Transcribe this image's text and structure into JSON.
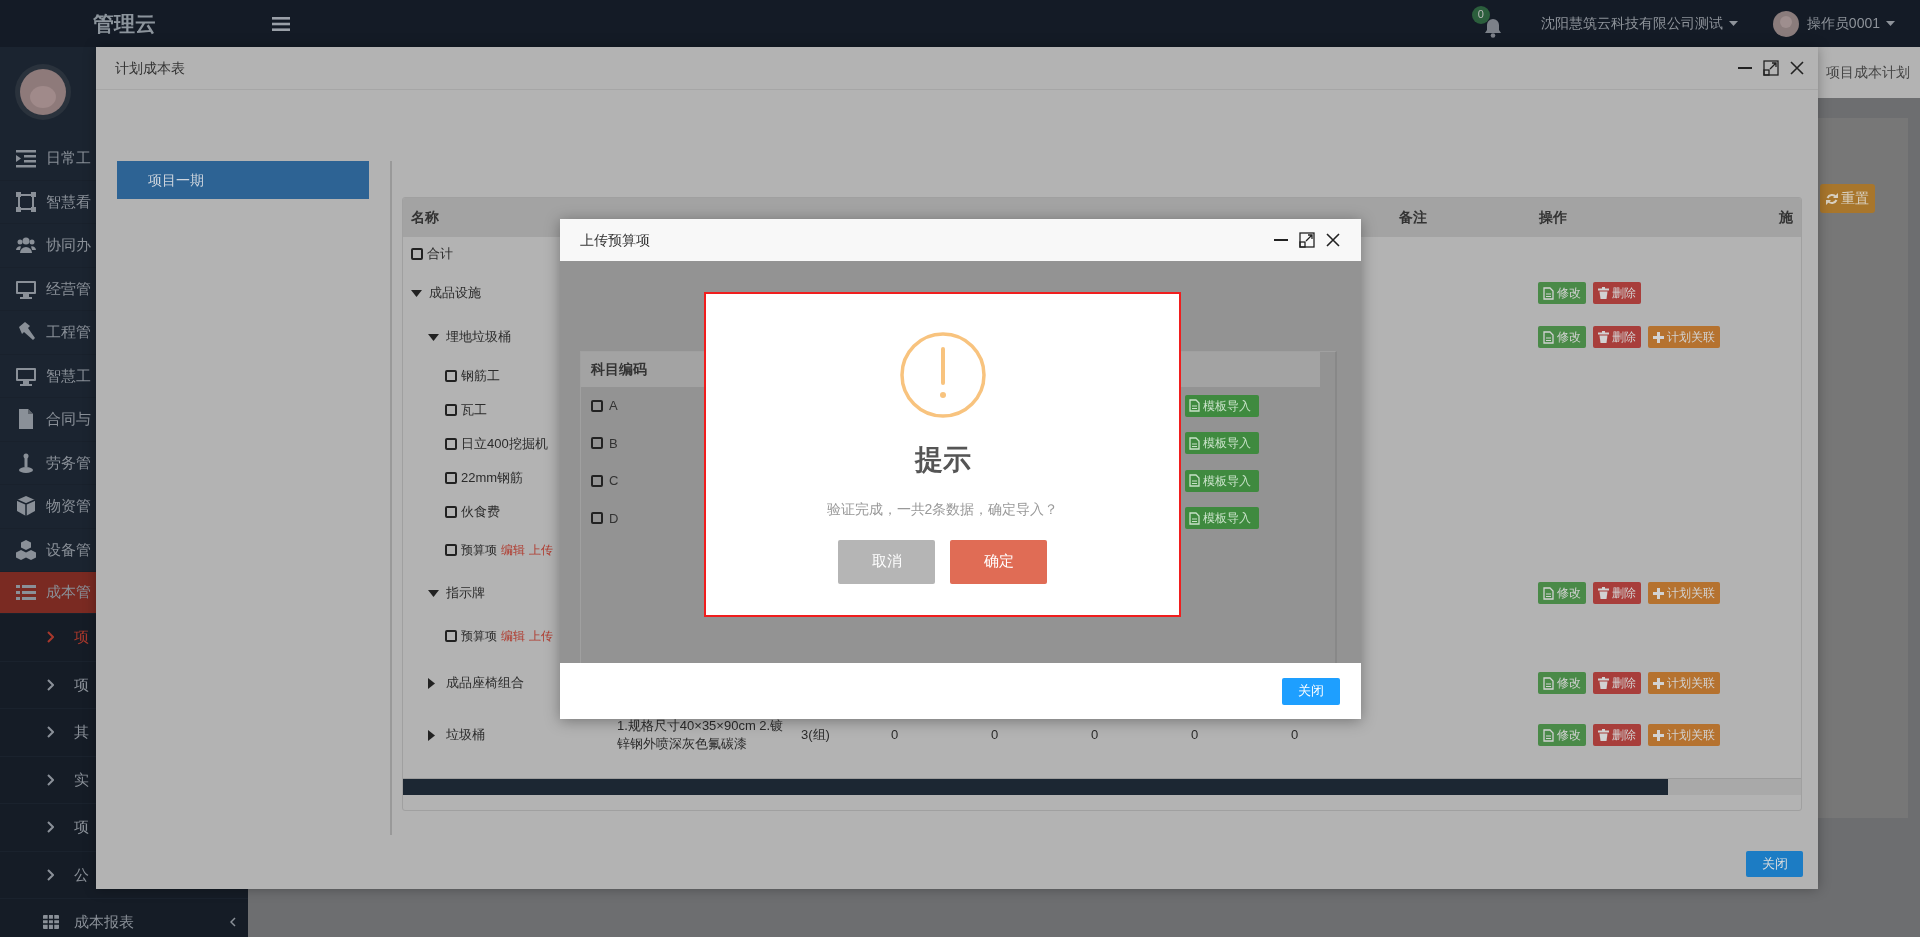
{
  "topbar": {
    "logo": "管理云",
    "notification_count": "0",
    "company": "沈阳慧筑云科技有限公司测试",
    "user": "操作员0001"
  },
  "sidebar": {
    "items": [
      {
        "label": "日常工",
        "selected": false
      },
      {
        "label": "智慧看",
        "selected": false
      },
      {
        "label": "协同办",
        "selected": false
      },
      {
        "label": "经营管",
        "selected": false
      },
      {
        "label": "工程管",
        "selected": false
      },
      {
        "label": "智慧工",
        "selected": false
      },
      {
        "label": "合同与",
        "selected": false
      },
      {
        "label": "劳务管",
        "selected": false
      },
      {
        "label": "物资管",
        "selected": false
      },
      {
        "label": "设备管",
        "selected": false
      },
      {
        "label": "成本管",
        "selected": true,
        "children": [
          {
            "label": "项",
            "kind": "link",
            "selected": true
          },
          {
            "label": "项",
            "kind": "link",
            "selected": false
          },
          {
            "label": "其",
            "kind": "link",
            "selected": false
          },
          {
            "label": "实",
            "kind": "link",
            "selected": false
          },
          {
            "label": "项",
            "kind": "link",
            "selected": false
          },
          {
            "label": "公",
            "kind": "link",
            "selected": false
          },
          {
            "label": "成本报表",
            "kind": "group",
            "selected": false
          }
        ]
      }
    ]
  },
  "page": {
    "breadcrumb": "项目成本计划",
    "reset_button": "重置"
  },
  "plan_window": {
    "title": "计划成本表",
    "projects": [
      {
        "label": "项目一期",
        "selected": true
      }
    ],
    "table": {
      "columns": [
        {
          "label": "名称",
          "kind": "name"
        },
        {
          "label": "备注",
          "kind": "remark"
        },
        {
          "label": "操作",
          "kind": "actions"
        },
        {
          "label": "施",
          "kind": "extra"
        }
      ],
      "rows": [
        {
          "name": "合计",
          "kind": "item",
          "checked": false
        },
        {
          "name": "成品设施",
          "kind": "group",
          "expanded": true,
          "actions": [
            {
              "label": "修改",
              "kind": "edit"
            },
            {
              "label": "删除",
              "kind": "delete"
            }
          ],
          "children": [
            {
              "name": "埋地垃圾桶",
              "kind": "group",
              "expanded": true,
              "actions": [
                {
                  "label": "修改",
                  "kind": "edit"
                },
                {
                  "label": "删除",
                  "kind": "delete"
                },
                {
                  "label": "计划关联",
                  "kind": "link"
                }
              ],
              "children": [
                {
                  "name": "钢筋工",
                  "kind": "item",
                  "checked": false
                },
                {
                  "name": "瓦工",
                  "kind": "item",
                  "checked": false
                },
                {
                  "name": "日立400挖掘机",
                  "kind": "item",
                  "checked": false
                },
                {
                  "name": "22mm钢筋",
                  "kind": "item",
                  "checked": false
                },
                {
                  "name": "伙食费",
                  "kind": "item",
                  "checked": false
                },
                {
                  "name": "预算项",
                  "kind": "budget",
                  "checked": false,
                  "links": [
                    "编辑",
                    "上传"
                  ]
                }
              ]
            },
            {
              "name": "指示牌",
              "kind": "group",
              "expanded": true,
              "actions": [
                {
                  "label": "修改",
                  "kind": "edit"
                },
                {
                  "label": "删除",
                  "kind": "delete"
                },
                {
                  "label": "计划关联",
                  "kind": "link"
                }
              ],
              "children": [
                {
                  "name": "预算项",
                  "kind": "budget",
                  "checked": false,
                  "links": [
                    "编辑",
                    "上传"
                  ]
                }
              ]
            },
            {
              "name": "成品座椅组合",
              "kind": "group",
              "expanded": false,
              "actions": [
                {
                  "label": "修改",
                  "kind": "edit"
                },
                {
                  "label": "删除",
                  "kind": "delete"
                },
                {
                  "label": "计划关联",
                  "kind": "link"
                }
              ]
            },
            {
              "name": "垃圾桶",
              "kind": "group",
              "expanded": false,
              "cells": [
                "1.规格尺寸40×35×90cm 2.镀锌钢外喷深灰色氟碳漆",
                "3(组)",
                "0",
                "0",
                "0",
                "0",
                "0"
              ],
              "actions": [
                {
                  "label": "修改",
                  "kind": "edit"
                },
                {
                  "label": "删除",
                  "kind": "delete"
                },
                {
                  "label": "计划关联",
                  "kind": "link"
                }
              ]
            }
          ]
        }
      ]
    },
    "close_button": "关闭"
  },
  "upload_window": {
    "title": "上传预算项",
    "table": {
      "columns": [
        "科目编码"
      ],
      "rows": [
        {
          "code": "A",
          "checked": false,
          "action": "模板导入"
        },
        {
          "code": "B",
          "checked": false,
          "action": "模板导入"
        },
        {
          "code": "C",
          "checked": false,
          "action": "模板导入"
        },
        {
          "code": "D",
          "checked": false,
          "action": "模板导入"
        }
      ]
    },
    "close_button": "关闭"
  },
  "alert": {
    "title": "提示",
    "message": "验证完成，一共2条数据，确定导入？",
    "buttons": [
      {
        "label": "取消",
        "kind": "cancel"
      },
      {
        "label": "确定",
        "kind": "confirm"
      }
    ]
  }
}
